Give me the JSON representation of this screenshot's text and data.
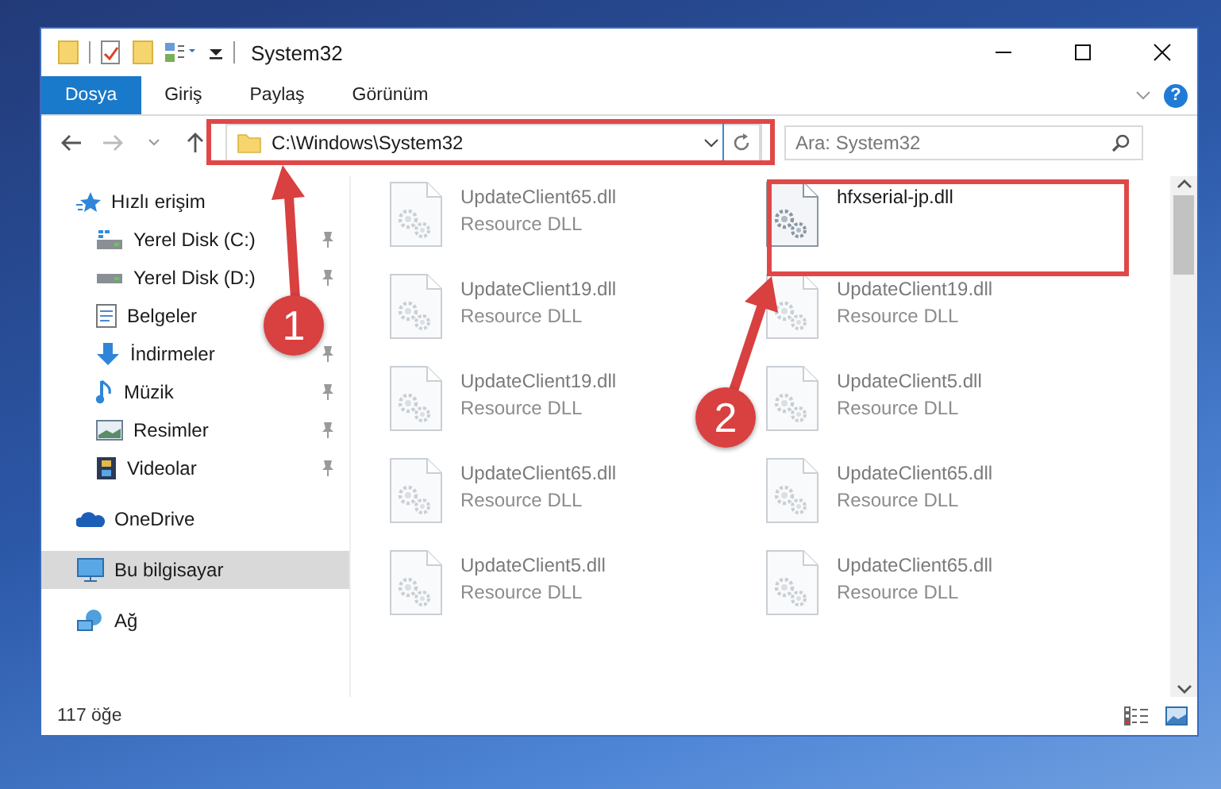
{
  "window": {
    "title": "System32"
  },
  "ribbon": {
    "tabs": [
      {
        "label": "Dosya",
        "selected": true
      },
      {
        "label": "Giriş",
        "selected": false
      },
      {
        "label": "Paylaş",
        "selected": false
      },
      {
        "label": "Görünüm",
        "selected": false
      }
    ],
    "help": "?"
  },
  "address": {
    "path": "C:\\Windows\\System32"
  },
  "search": {
    "placeholder": "Ara: System32"
  },
  "sidebar": {
    "items": [
      {
        "label": "Hızlı erişim",
        "selected": false,
        "children": [
          {
            "label": "Yerel Disk (C:)",
            "pinned": true,
            "selected": false
          },
          {
            "label": "Yerel Disk (D:)",
            "pinned": true,
            "selected": false
          },
          {
            "label": "Belgeler",
            "pinned": false,
            "selected": false
          },
          {
            "label": "İndirmeler",
            "pinned": true,
            "selected": false
          },
          {
            "label": "Müzik",
            "pinned": true,
            "selected": false
          },
          {
            "label": "Resimler",
            "pinned": true,
            "selected": false
          },
          {
            "label": "Videolar",
            "pinned": true,
            "selected": false
          }
        ]
      },
      {
        "label": "OneDrive",
        "selected": false
      },
      {
        "label": "Bu bilgisayar",
        "selected": true
      },
      {
        "label": "Ağ",
        "selected": false
      }
    ]
  },
  "files": [
    {
      "name": "UpdateClient65.dll",
      "type": "Resource DLL",
      "blurred": true
    },
    {
      "name": "hfxserial-jp.dll",
      "blurred": false
    },
    {
      "name": "UpdateClient19.dll",
      "type": "Resource DLL",
      "blurred": true
    },
    {
      "name": "UpdateClient19.dll",
      "type": "Resource DLL",
      "blurred": true
    },
    {
      "name": "UpdateClient19.dll",
      "type": "Resource DLL",
      "blurred": true
    },
    {
      "name": "UpdateClient5.dll",
      "type": "Resource DLL",
      "blurred": true
    },
    {
      "name": "UpdateClient65.dll",
      "type": "Resource DLL",
      "blurred": true
    },
    {
      "name": "UpdateClient65.dll",
      "type": "Resource DLL",
      "blurred": true
    },
    {
      "name": "UpdateClient5.dll",
      "type": "Resource DLL",
      "blurred": true
    },
    {
      "name": "UpdateClient65.dll",
      "type": "Resource DLL",
      "blurred": true
    }
  ],
  "status_bar": {
    "count": "117 öğe"
  },
  "annotations": [
    {
      "number": "1"
    },
    {
      "number": "2"
    }
  ]
}
